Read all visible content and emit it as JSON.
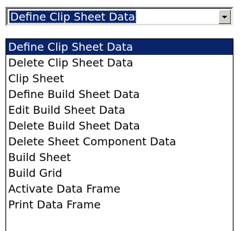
{
  "combo": {
    "selected_value": "Define Clip Sheet Data",
    "dropdown_icon": "chevron-down-icon"
  },
  "list": {
    "selected_index": 0,
    "items": [
      {
        "label": "Define Clip Sheet Data"
      },
      {
        "label": "Delete Clip Sheet Data"
      },
      {
        "label": "Clip Sheet"
      },
      {
        "label": "Define Build Sheet Data"
      },
      {
        "label": "Edit Build Sheet Data"
      },
      {
        "label": "Delete Build Sheet Data"
      },
      {
        "label": "Delete Sheet Component Data"
      },
      {
        "label": "Build Sheet"
      },
      {
        "label": "Build Grid"
      },
      {
        "label": "Activate Data Frame"
      },
      {
        "label": "Print Data Frame"
      }
    ]
  },
  "colors": {
    "selection_background": "#0a246a",
    "selection_text": "#ffffff",
    "button_face": "#d4d0c8"
  }
}
